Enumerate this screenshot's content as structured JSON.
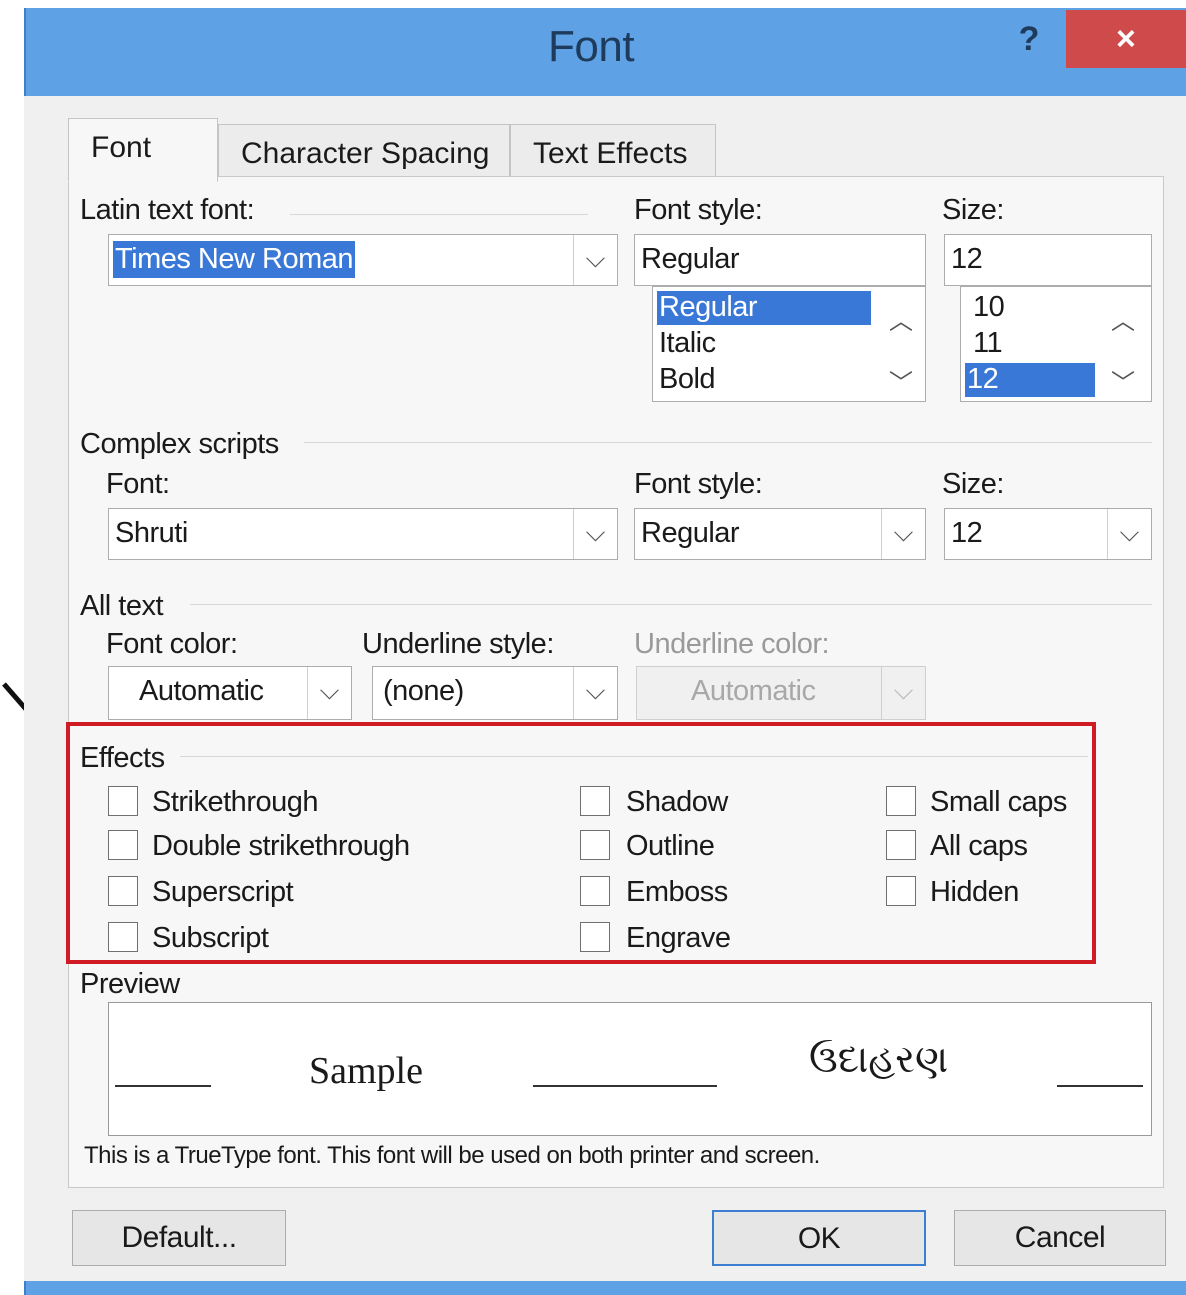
{
  "window": {
    "title": "Font",
    "help": "?",
    "close": "×"
  },
  "tabs": [
    "Font",
    "Character Spacing",
    "Text Effects"
  ],
  "latin": {
    "font_label": "Latin text font:",
    "font_value": "Times New Roman",
    "style_label": "Font style:",
    "style_value": "Regular",
    "style_list": [
      "Regular",
      "Italic",
      "Bold"
    ],
    "size_label": "Size:",
    "size_value": "12",
    "size_list": [
      "10",
      "11",
      "12"
    ]
  },
  "complex": {
    "section": "Complex scripts",
    "font_label": "Font:",
    "font_value": "Shruti",
    "style_label": "Font style:",
    "style_value": "Regular",
    "size_label": "Size:",
    "size_value": "12"
  },
  "all_text": {
    "section": "All text",
    "color_label": "Font color:",
    "color_value": "Automatic",
    "underline_style_label": "Underline style:",
    "underline_style_value": "(none)",
    "underline_color_label": "Underline color:",
    "underline_color_value": "Automatic"
  },
  "effects": {
    "section": "Effects",
    "col1": [
      "Strikethrough",
      "Double strikethrough",
      "Superscript",
      "Subscript"
    ],
    "col2": [
      "Shadow",
      "Outline",
      "Emboss",
      "Engrave"
    ],
    "col3": [
      "Small caps",
      "All caps",
      "Hidden"
    ]
  },
  "preview": {
    "section": "Preview",
    "sample": "Sample",
    "complex_sample": "ઉદાહરણ",
    "note": "This is a TrueType font. This font will be used on both printer and screen."
  },
  "buttons": {
    "default": "Default...",
    "ok": "OK",
    "cancel": "Cancel"
  },
  "icons": {
    "dropdown": "chevron-down-icon",
    "scroll_up": "chevron-up-icon",
    "pointer": "arrow-icon"
  },
  "colors": {
    "title_bar": "#5ea1e4",
    "close": "#cf4a4a",
    "selection": "#3a78d8",
    "highlight_frame": "#d01a24"
  }
}
